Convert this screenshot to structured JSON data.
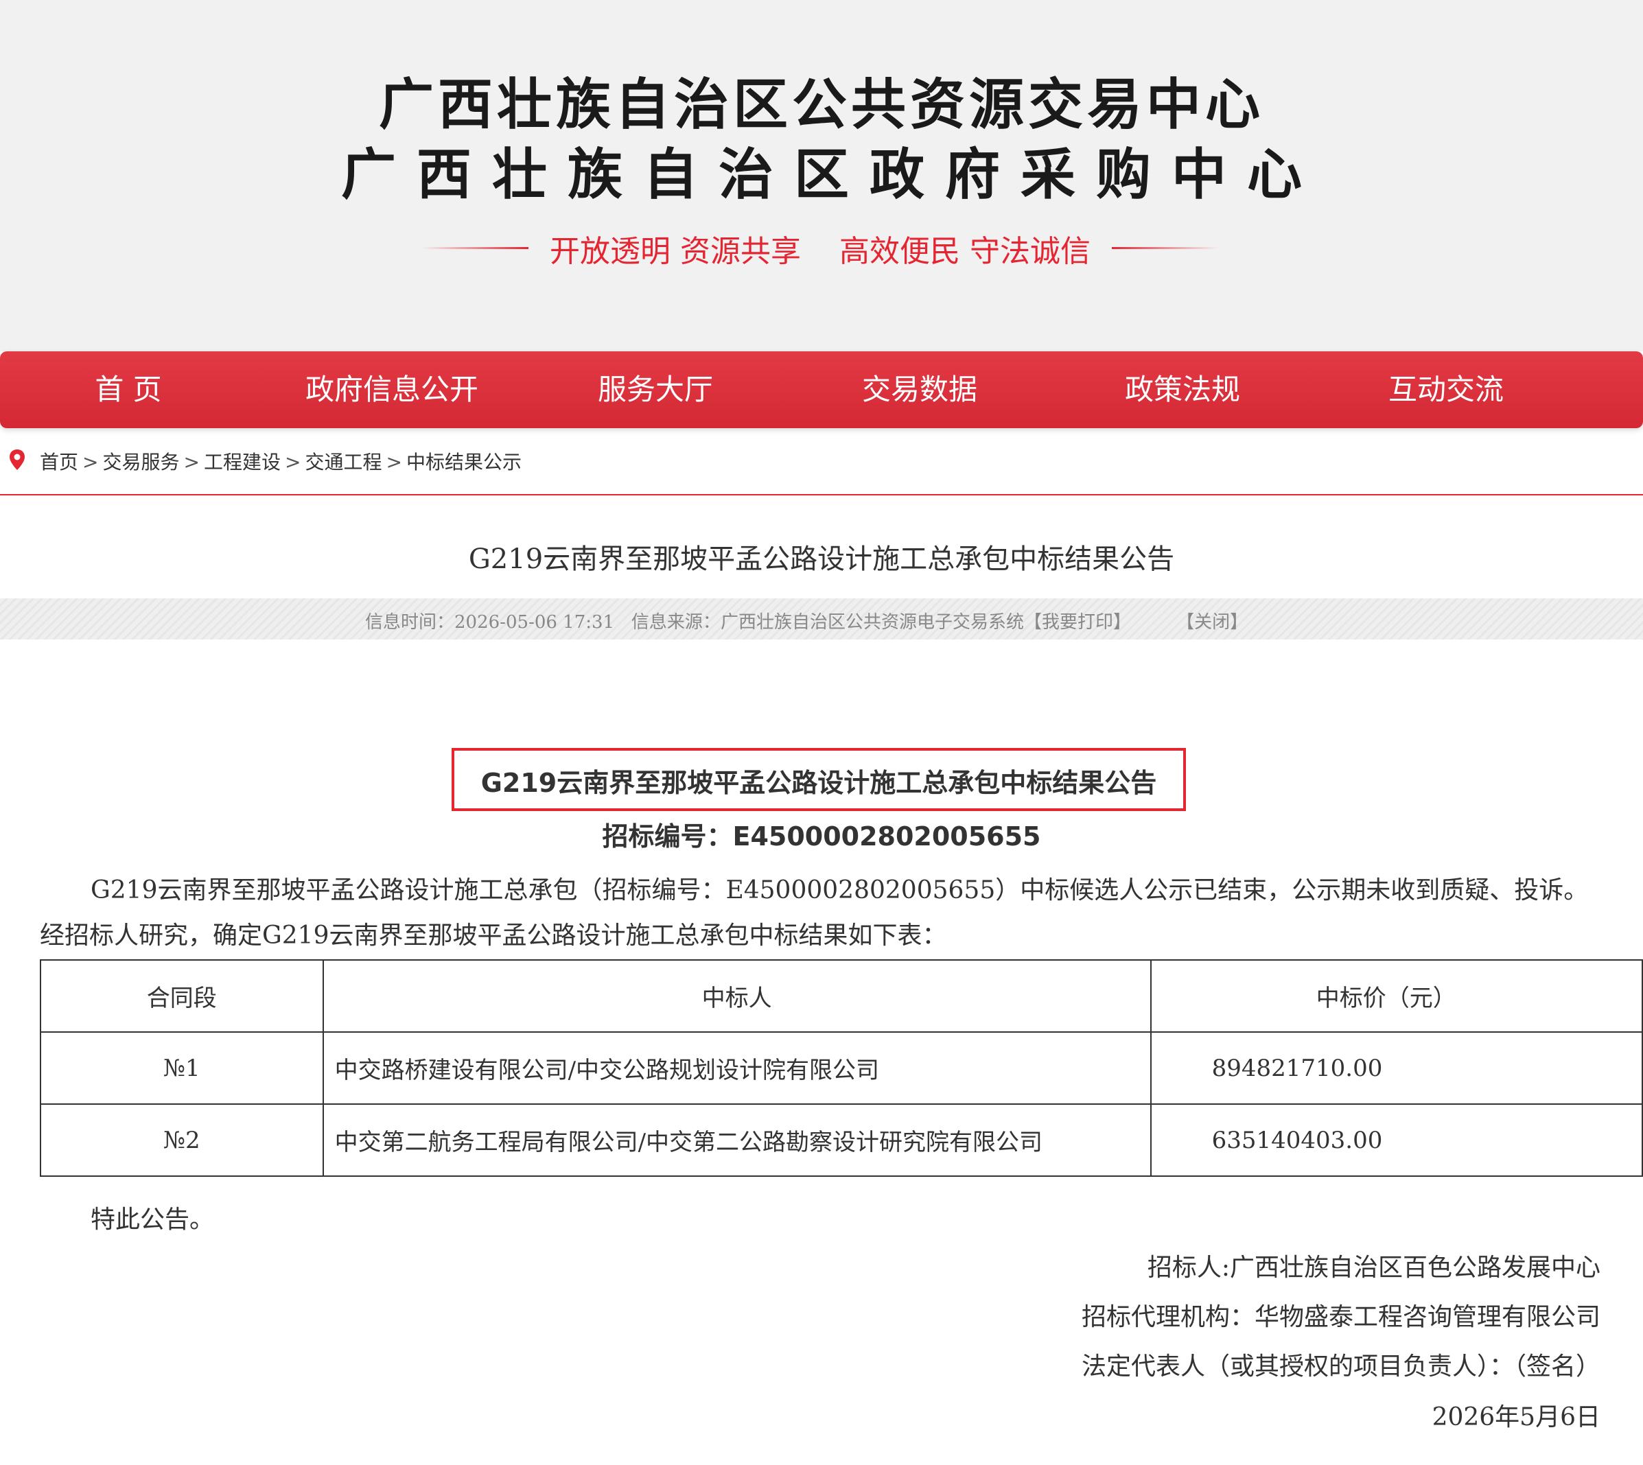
{
  "header": {
    "title_line1": "广西壮族自治区公共资源交易中心",
    "title_line2": "广西壮族自治区政府采购中心",
    "slogan": "开放透明 资源共享    高效便民 守法诚信",
    "accent_color": "#e42632"
  },
  "nav": {
    "items": [
      {
        "label": "首 页"
      },
      {
        "label": "政府信息公开"
      },
      {
        "label": "服务大厅"
      },
      {
        "label": "交易数据"
      },
      {
        "label": "政策法规"
      },
      {
        "label": "互动交流"
      }
    ]
  },
  "breadcrumb": {
    "icon": "location-pin-icon",
    "separator": ">",
    "items": [
      "首页",
      "交易服务",
      "工程建设",
      "交通工程",
      "中标结果公示"
    ]
  },
  "article": {
    "title": "G219云南界至那坡平孟公路设计施工总承包中标结果公告",
    "meta": {
      "time_label": "信息时间：",
      "time_value": "2026-05-06 17:31",
      "source_label": "信息来源：",
      "source_value": "广西壮族自治区公共资源电子交易系统",
      "print_link": "【我要打印】",
      "close_link": "【关闭】"
    }
  },
  "document": {
    "heading": "G219云南界至那坡平孟公路设计施工总承包中标结果公告",
    "code_line": "招标编号：E4500002802005655",
    "para1": "G219云南界至那坡平孟公路设计施工总承包（招标编号：E4500002802005655）中标候选人公示已结束，公示期未收到质疑、投诉。",
    "para2": "经招标人研究，确定G219云南界至那坡平孟公路设计施工总承包中标结果如下表：",
    "table": {
      "headers": [
        "合同段",
        "中标人",
        "中标价（元）"
      ],
      "rows": [
        {
          "section": "№1",
          "winner": "中交路桥建设有限公司/中交公路规划设计院有限公司",
          "price": "894821710.00"
        },
        {
          "section": "№2",
          "winner": "中交第二航务工程局有限公司/中交第二公路勘察设计研究院有限公司",
          "price": "635140403.00"
        }
      ]
    },
    "closing": "特此公告。",
    "signature": {
      "tenderer": "招标人:广西壮族自治区百色公路发展中心",
      "agency": "招标代理机构：华物盛泰工程咨询管理有限公司",
      "representative": "法定代表人（或其授权的项目负责人）：（签名）",
      "date": "2026年5月6日"
    }
  }
}
